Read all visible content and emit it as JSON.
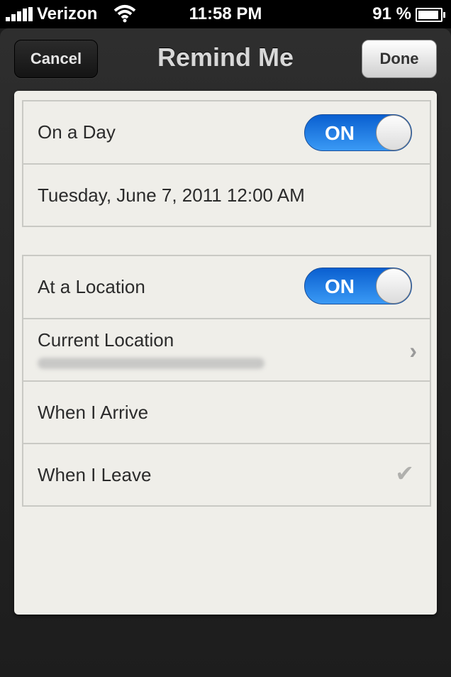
{
  "status_bar": {
    "carrier": "Verizon",
    "time": "11:58 PM",
    "battery": "91 %"
  },
  "nav": {
    "title": "Remind Me",
    "cancel_label": "Cancel",
    "done_label": "Done"
  },
  "day_group": {
    "toggle_label": "On a Day",
    "toggle_state": "ON",
    "date": "Tuesday, June 7, 2011 12:00 AM"
  },
  "location_group": {
    "toggle_label": "At a Location",
    "toggle_state": "ON",
    "location_label": "Current Location",
    "arrive_label": "When I Arrive",
    "leave_label": "When I Leave",
    "selected_option": "When I Leave"
  },
  "colors": {
    "toggle_on": "#1a7be8",
    "panel": "#efeee9",
    "frame": "#252525"
  },
  "icons": [
    "signal-bars-icon",
    "wifi-icon",
    "battery-icon",
    "chevron-right-icon",
    "checkmark-icon"
  ]
}
